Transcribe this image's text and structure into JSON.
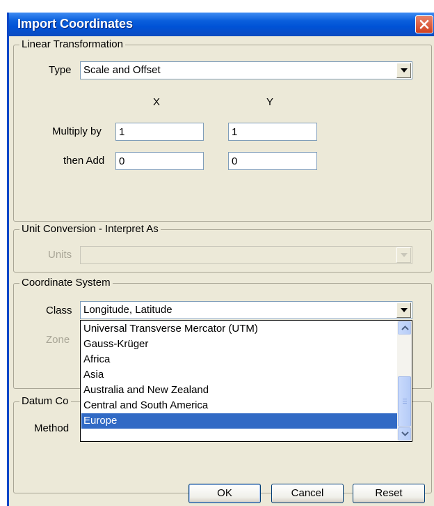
{
  "dialog": {
    "title": "Import Coordinates"
  },
  "linear_transformation": {
    "legend": "Linear Transformation",
    "type_label": "Type",
    "type_value": "Scale and Offset",
    "col_x": "X",
    "col_y": "Y",
    "multiply_label": "Multiply by",
    "multiply_x": "1",
    "multiply_y": "1",
    "add_label": "then Add",
    "add_x": "0",
    "add_y": "0"
  },
  "unit_conversion": {
    "legend": "Unit Conversion - Interpret As",
    "units_label": "Units",
    "units_value": ""
  },
  "coordinate_system": {
    "legend": "Coordinate System",
    "class_label": "Class",
    "class_value": "Longitude, Latitude",
    "zone_label": "Zone",
    "class_options": [
      "Universal Transverse Mercator (UTM)",
      "Gauss-Krüger",
      "Africa",
      "Asia",
      "Australia and New Zealand",
      "Central and South America",
      "Europe"
    ],
    "selected_option": "Europe"
  },
  "datum_conversion": {
    "legend": "Datum Co",
    "method_label": "Method"
  },
  "buttons": {
    "ok": "OK",
    "cancel": "Cancel",
    "reset": "Reset"
  },
  "icons": {
    "close": "close-icon",
    "dropdown": "chevron-down-icon",
    "scroll_up": "chevron-up-icon",
    "scroll_down": "chevron-down-icon"
  },
  "colors": {
    "titlebar": "#0a5fdc",
    "selection": "#316ac5",
    "dialog_bg": "#ece9d8"
  }
}
